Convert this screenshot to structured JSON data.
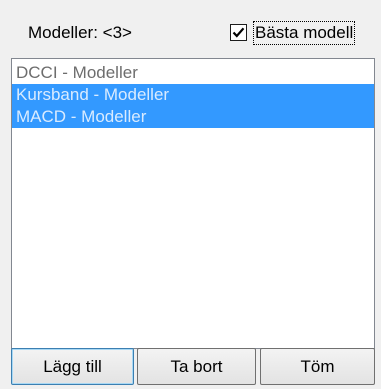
{
  "models_label": "Modeller: <3>",
  "best_models": {
    "label": "Bästa modell",
    "checked": true
  },
  "list": {
    "items": [
      {
        "label": "DCCI - Modeller",
        "selected": false
      },
      {
        "label": "Kursband - Modeller",
        "selected": true
      },
      {
        "label": "MACD - Modeller",
        "selected": true
      }
    ]
  },
  "buttons": {
    "add": "Lägg till",
    "remove": "Ta bort",
    "clear": "Töm"
  },
  "colors": {
    "selection": "#3399ff",
    "selected_text": "#d9ebff",
    "item_text": "#6d6d6d"
  }
}
